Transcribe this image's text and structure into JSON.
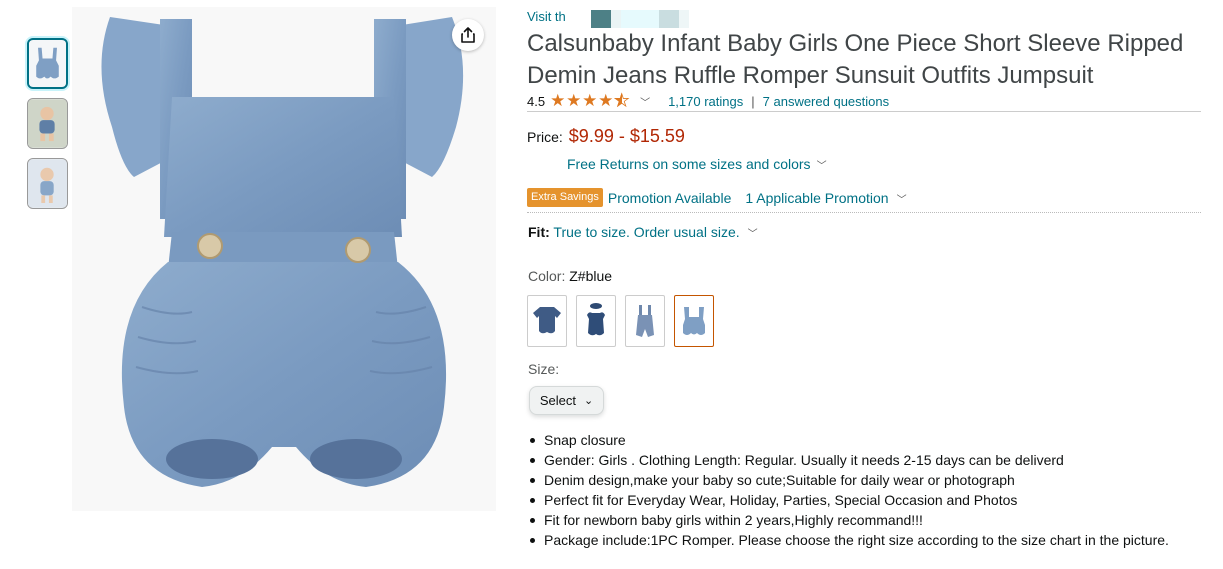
{
  "store": {
    "link_text": "Visit th"
  },
  "product": {
    "title": "Calsunbaby Infant Baby Girls One Piece Short Sleeve Ripped Demin Jeans Ruffle Romper Sunsuit Outfits Jumpsuit",
    "rating_value": "4.5",
    "stars": 4.5,
    "ratings_count": "1,170 ratings",
    "separator": "|",
    "answered_questions": "7 answered questions"
  },
  "price": {
    "label": "Price:",
    "value": "$9.99 - $15.59",
    "free_returns": "Free Returns on some sizes and colors"
  },
  "promotion": {
    "badge": "Extra Savings",
    "text": "Promotion Available",
    "link": "1 Applicable Promotion"
  },
  "fit": {
    "label": "Fit:",
    "value": "True to size. Order usual size."
  },
  "color": {
    "label": "Color:",
    "selected": "Z#blue",
    "swatches": [
      "shirt-romper",
      "bow-romper",
      "overall-romper",
      "ruffle-romper"
    ]
  },
  "size": {
    "label": "Size:",
    "select_value": "Select"
  },
  "bullets": [
    "Snap closure",
    "Gender: Girls . Clothing Length: Regular. Usually it needs 2-15 days can be deliverd",
    "Denim design,make your baby so cute;Suitable for daily wear or photograph",
    "Perfect fit for Everyday Wear, Holiday, Parties, Special Occasion and Photos",
    "Fit for newborn baby girls within 2 years,Highly recommand!!!",
    "Package include:1PC Romper. Please choose the right size according to the size chart in the picture."
  ],
  "icons": {
    "share": "share-icon",
    "chevron": "chevron-down-icon"
  },
  "colors": {
    "link": "#007185",
    "price": "#b12704",
    "star": "#de7921",
    "badge": "#e5932d",
    "denim": "#7f9fc4"
  }
}
